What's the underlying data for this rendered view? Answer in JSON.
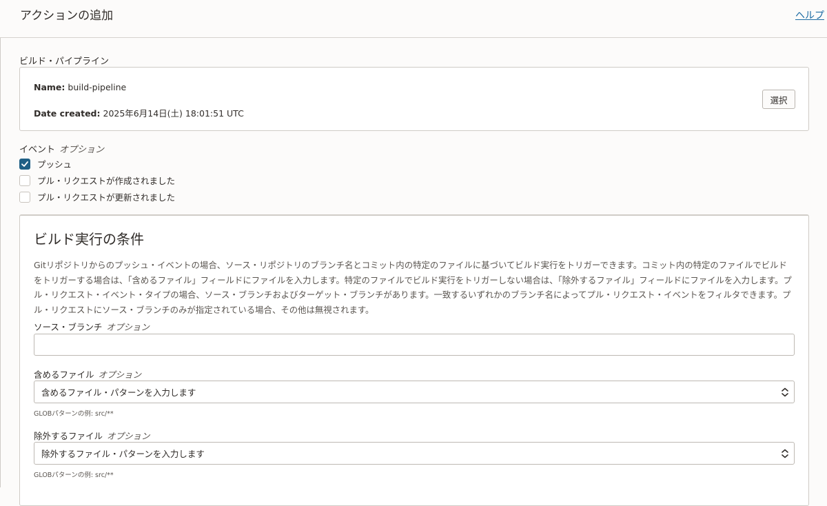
{
  "header": {
    "title": "アクションの追加",
    "help": "ヘルプ"
  },
  "pipeline": {
    "section_label": "ビルド・パイプライン",
    "name_label": "Name:",
    "name_value": "build-pipeline",
    "date_label": "Date created:",
    "date_value": "2025年6月14日(土) 18:01:51 UTC",
    "select_button": "選択"
  },
  "events": {
    "label": "イベント",
    "optional": "オプション",
    "items": [
      {
        "label": "プッシュ",
        "checked": true
      },
      {
        "label": "プル・リクエストが作成されました",
        "checked": false
      },
      {
        "label": "プル・リクエストが更新されました",
        "checked": false
      }
    ]
  },
  "conditions": {
    "title": "ビルド実行の条件",
    "description": "Gitリポジトリからのプッシュ・イベントの場合、ソース・リポジトリのブランチ名とコミット内の特定のファイルに基づいてビルド実行をトリガーできます。コミット内の特定のファイルでビルドをトリガーする場合は、「含めるファイル」フィールドにファイルを入力します。特定のファイルでビルド実行をトリガーしない場合は、「除外するファイル」フィールドにファイルを入力します。プル・リクエスト・イベント・タイプの場合、ソース・ブランチおよびターゲット・ブランチがあります。一致するいずれかのブランチ名によってプル・リクエスト・イベントをフィルタできます。プル・リクエストにソース・ブランチのみが指定されている場合、その他は無視されます。",
    "source_branch": {
      "label": "ソース・ブランチ",
      "optional": "オプション",
      "value": ""
    },
    "include_files": {
      "label": "含めるファイル",
      "optional": "オプション",
      "placeholder": "含めるファイル・パターンを入力します",
      "hint": "GLOBパターンの例: src/**"
    },
    "exclude_files": {
      "label": "除外するファイル",
      "optional": "オプション",
      "placeholder": "除外するファイル・パターンを入力します",
      "hint": "GLOBパターンの例: src/**"
    }
  },
  "colors": {
    "accent": "#1f5f85",
    "link": "#1a6aa3",
    "border": "#cfcbc6"
  },
  "icons": {
    "check": "check-icon",
    "updown": "chevron-up-down-icon"
  }
}
